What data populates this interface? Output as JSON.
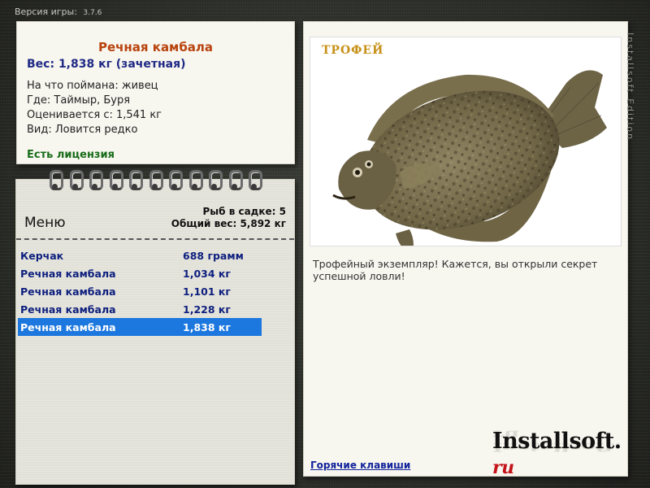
{
  "version": {
    "label": "Версия игры:",
    "number": "3.7.6"
  },
  "catch_info": {
    "title": "Речная камбала",
    "weight_line": "Вес: 1,838 кг (зачетная)",
    "bait_line": "На что поймана: живец",
    "place_line": "Где: Таймыр, Буря",
    "rated_line": "Оценивается с: 1,541 кг",
    "kind_line": "Вид: Ловится редко",
    "license": "Есть лицензия"
  },
  "menu": {
    "label": "Меню",
    "fish_count": "Рыб в садке: 5",
    "total_weight": "Общий вес: 5,892 кг",
    "items": [
      {
        "name": "Керчак",
        "weight": "688 грамм"
      },
      {
        "name": "Речная камбала",
        "weight": "1,034 кг"
      },
      {
        "name": "Речная камбала",
        "weight": "1,101 кг"
      },
      {
        "name": "Речная камбала",
        "weight": "1,228 кг"
      },
      {
        "name": "Речная камбала",
        "weight": "1,838 кг"
      }
    ],
    "selected_index": 4
  },
  "trophy": {
    "label": "ТРОФЕЙ",
    "description": "Трофейный экземпляр! Кажется, вы открыли секрет успешной ловли!",
    "hotkeys": "Горячие клавиши"
  },
  "branding": {
    "logo_main": "Installsoft.",
    "logo_ru": "ru",
    "side_text": "Installsoft Edition"
  },
  "colors": {
    "selected_row": "#1c77de",
    "title_red": "#b8430e",
    "navy": "#202a85",
    "license_green": "#196d1a",
    "trophy_gold": "#c79017"
  }
}
